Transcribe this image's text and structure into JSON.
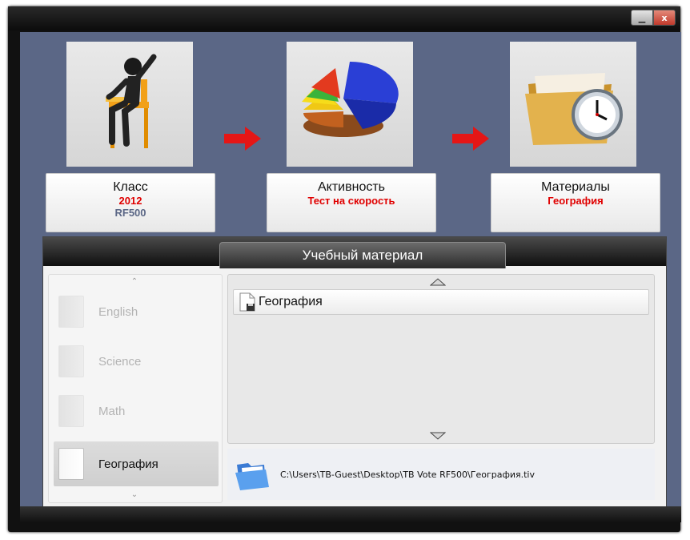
{
  "window": {
    "controls": {
      "minimize_icon": "minimize-icon",
      "close_label": "x"
    }
  },
  "steps": [
    {
      "title": "Класс",
      "line1": "2012",
      "line2": "RF500",
      "icon": "student-figure-icon"
    },
    {
      "title": "Активность",
      "line1": "Тест на скорость",
      "icon": "pie-chart-icon"
    },
    {
      "title": "Материалы",
      "line1": "География",
      "icon": "folder-clock-icon"
    }
  ],
  "colors": {
    "accent_red": "#e00000",
    "sub_blue": "#5b6786",
    "background": "#5b6786"
  },
  "panel": {
    "title": "Учебный материал",
    "subjects": [
      {
        "label": "English",
        "selected": false
      },
      {
        "label": "Science",
        "selected": false
      },
      {
        "label": "Math",
        "selected": false
      },
      {
        "label": "География",
        "selected": true
      }
    ],
    "files": [
      {
        "label": "География",
        "icon": "document-disk-icon"
      }
    ],
    "path": "C:\\Users\\TB-Guest\\Desktop\\TB Vote RF500\\География.tiv"
  }
}
